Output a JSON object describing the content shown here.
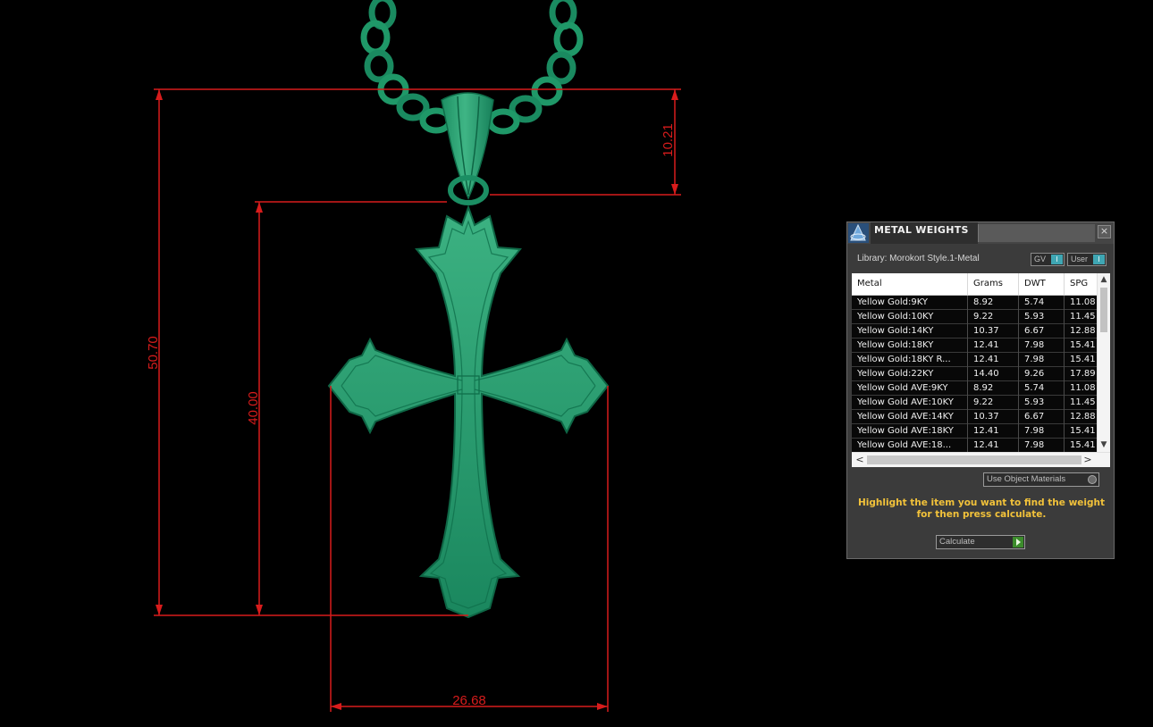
{
  "viewport": {
    "dimensions": {
      "overall_height": "50.70",
      "cross_height": "40.00",
      "bail_height": "10.21",
      "width": "26.68"
    },
    "colors": {
      "background": "#000000",
      "dimension_lines": "#d81c1c",
      "model": "#1f9e6e"
    }
  },
  "panel": {
    "title": "METAL WEIGHTS",
    "close_icon": "×",
    "library": "Library: Morokort Style.1-Metal",
    "gv_label": "GV",
    "user_label": "User",
    "toggle_indicator": "I",
    "columns": [
      "Metal",
      "Grams",
      "DWT",
      "SPG"
    ],
    "rows": [
      {
        "metal": "Yellow Gold:9KY",
        "grams": "8.92",
        "dwt": "5.74",
        "spg": "11.08"
      },
      {
        "metal": "Yellow Gold:10KY",
        "grams": "9.22",
        "dwt": "5.93",
        "spg": "11.45"
      },
      {
        "metal": "Yellow Gold:14KY",
        "grams": "10.37",
        "dwt": "6.67",
        "spg": "12.88"
      },
      {
        "metal": "Yellow Gold:18KY",
        "grams": "12.41",
        "dwt": "7.98",
        "spg": "15.41"
      },
      {
        "metal": "Yellow Gold:18KY R...",
        "grams": "12.41",
        "dwt": "7.98",
        "spg": "15.41"
      },
      {
        "metal": "Yellow Gold:22KY",
        "grams": "14.40",
        "dwt": "9.26",
        "spg": "17.89"
      },
      {
        "metal": "Yellow Gold AVE:9KY",
        "grams": "8.92",
        "dwt": "5.74",
        "spg": "11.08"
      },
      {
        "metal": "Yellow Gold AVE:10KY",
        "grams": "9.22",
        "dwt": "5.93",
        "spg": "11.45"
      },
      {
        "metal": "Yellow Gold AVE:14KY",
        "grams": "10.37",
        "dwt": "6.67",
        "spg": "12.88"
      },
      {
        "metal": "Yellow Gold AVE:18KY",
        "grams": "12.41",
        "dwt": "7.98",
        "spg": "15.41"
      },
      {
        "metal": "Yellow Gold AVE:18...",
        "grams": "12.41",
        "dwt": "7.98",
        "spg": "15.41"
      }
    ],
    "scroll_up": "▲",
    "scroll_down": "▼",
    "scroll_left": "<",
    "scroll_right": ">",
    "use_object_materials": "Use Object Materials",
    "hint": "Highlight the item you want to find the weight for then press calculate.",
    "calculate_label": "Calculate",
    "colors": {
      "panel_bg": "#3b3b3b",
      "hint_text": "#f2c23a",
      "toggle_accent": "#3fa6b3",
      "calculate_accent": "#3c8c2c"
    }
  }
}
